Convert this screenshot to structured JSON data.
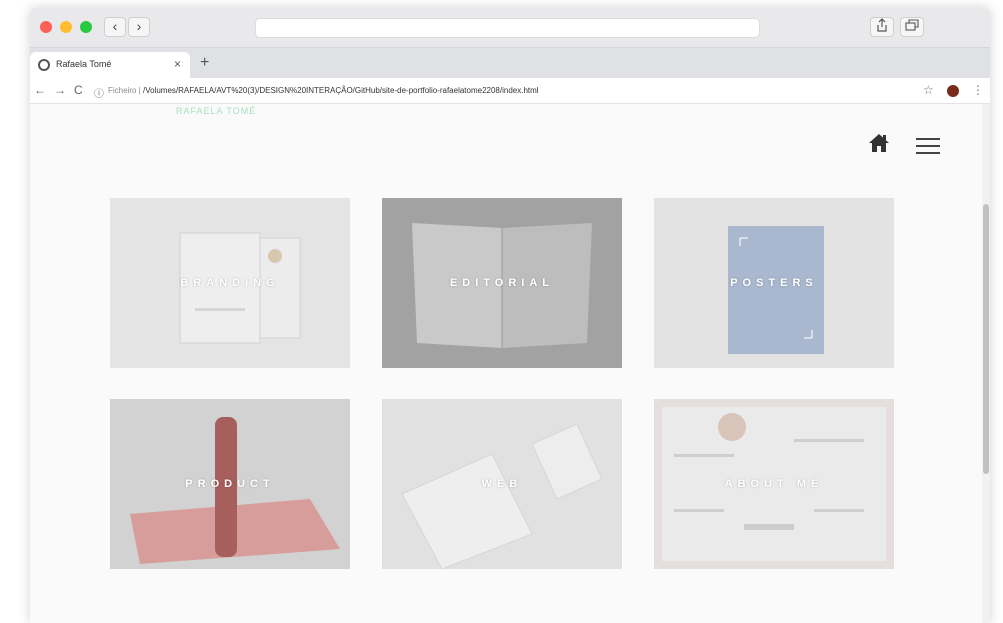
{
  "browser": {
    "nav_back": "‹",
    "nav_forward": "›",
    "tab": {
      "title": "Rafaela Tomé",
      "close": "×"
    },
    "new_tab": "+",
    "address": {
      "back": "←",
      "forward": "→",
      "reload": "C",
      "info": "ⓘ",
      "scheme": "Ficheiro | ",
      "url": "/Volumes/RAFAELA/AVT%20(3)/DESIGN%20INTERAÇÃO/GitHub/site-de-portfolio-rafaelatome2208/index.html",
      "star": "☆",
      "kebab": "⋮"
    }
  },
  "site": {
    "brand": "RAFAELA TOMÉ",
    "colors": {
      "brand": "#a8e0c2"
    },
    "cards": [
      {
        "label": "BRANDING"
      },
      {
        "label": "EDITORIAL"
      },
      {
        "label": "POSTERS"
      },
      {
        "label": "PRODUCT"
      },
      {
        "label": "WEB"
      },
      {
        "label": "ABOUT ME"
      }
    ]
  },
  "icons": [
    "home-icon",
    "hamburger-menu-icon",
    "share-icon",
    "tabs-icon",
    "star-icon",
    "globe-icon"
  ]
}
